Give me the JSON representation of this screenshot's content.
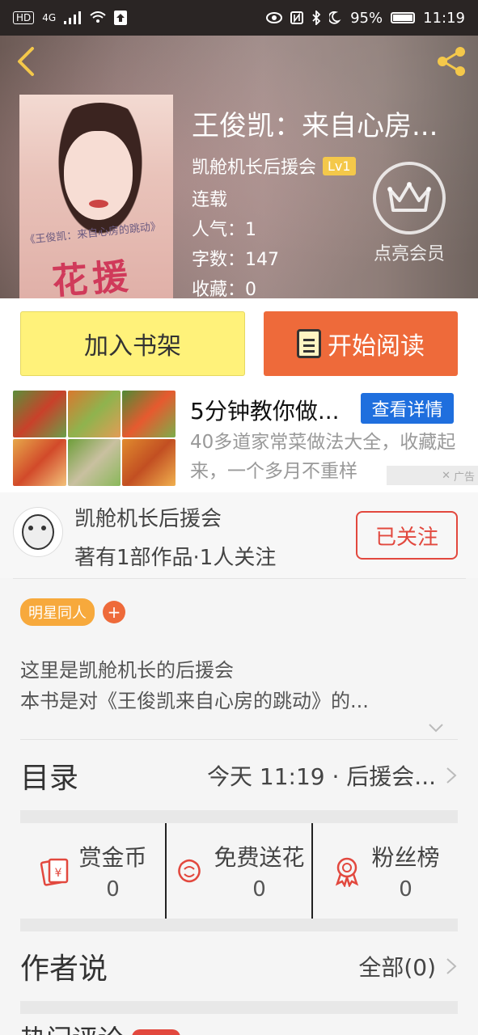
{
  "status_bar": {
    "network": "HD",
    "signal": "4G",
    "battery": "95%",
    "time": "11:19"
  },
  "book": {
    "title": "王俊凯：来自心房...",
    "author": "凯舱机长后援会",
    "level": "Lv1",
    "status": "连载",
    "popularity": "人气：1",
    "word_count": "字数：147",
    "favorites": "收藏：0",
    "cover_script": "《王俊凯：来自心房的跳动》",
    "cover_big_text": "花援"
  },
  "vip": {
    "label": "点亮会员"
  },
  "actions": {
    "add_shelf": "加入书架",
    "start_read": "开始阅读"
  },
  "ad": {
    "title": "5分钟教你做...",
    "cta": "查看详情",
    "description": "40多道家常菜做法大全，收藏起来，一个多月不重样",
    "tag": "广告"
  },
  "author_card": {
    "name": "凯舱机长后援会",
    "stats": "著有1部作品·1人关注",
    "follow": "已关注"
  },
  "tags": [
    "明星同人"
  ],
  "description": {
    "line1": "这里是凯舱机长的后援会",
    "line2": "本书是对《王俊凯来自心房的跳动》的..."
  },
  "toc": {
    "label": "目录",
    "value": "今天 11:19 · 后援会..."
  },
  "stats": [
    {
      "name": "赏金币",
      "value": "0"
    },
    {
      "name": "免费送花",
      "value": "0"
    },
    {
      "name": "粉丝榜",
      "value": "0"
    }
  ],
  "author_says": {
    "label": "作者说",
    "value": "全部(0)"
  },
  "next_section": {
    "label": "热门评论"
  },
  "colors": {
    "accent_yellow": "#f4c84a",
    "shelf_yellow": "#fff27a",
    "read_orange": "#ee6a3a",
    "follow_red": "#e2483e",
    "ad_blue": "#1f6fde",
    "tag_orange": "#f7a93c"
  }
}
